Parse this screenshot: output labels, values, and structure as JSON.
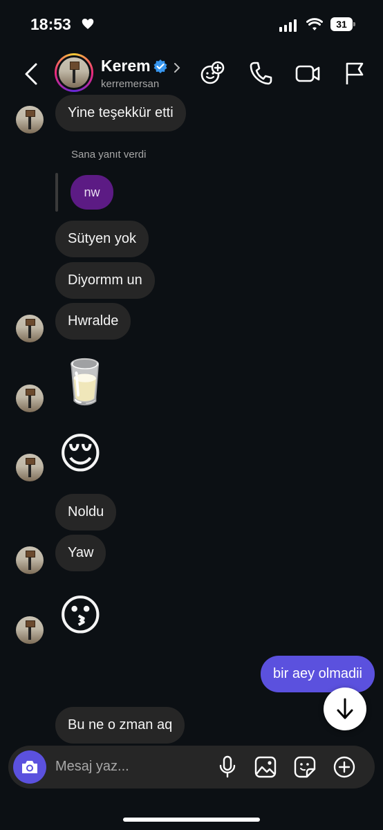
{
  "status_bar": {
    "time": "18:53",
    "battery": "31"
  },
  "header": {
    "name": "Kerem",
    "username": "kerremersan",
    "icons": [
      "back-icon",
      "verified-icon",
      "chevron-right-icon",
      "effects-icon",
      "phone-icon",
      "video-icon",
      "flag-icon"
    ]
  },
  "messages": [
    {
      "from": "them",
      "type": "text",
      "text": "Yine teşekkür etti"
    },
    {
      "from": "them",
      "type": "reply",
      "note": "Sana yanıt verdi",
      "quoted": "nw"
    },
    {
      "from": "them",
      "type": "text",
      "text": "Sütyen yok"
    },
    {
      "from": "them",
      "type": "text",
      "text": "Diyormm un"
    },
    {
      "from": "them",
      "type": "text",
      "text": "Hwralde"
    },
    {
      "from": "them",
      "type": "emoji",
      "text": "🥛"
    },
    {
      "from": "them",
      "type": "emoji",
      "text": "😌"
    },
    {
      "from": "them",
      "type": "text",
      "text": "Noldu"
    },
    {
      "from": "them",
      "type": "text",
      "text": "Yaw"
    },
    {
      "from": "them",
      "type": "emoji",
      "text": "😗"
    },
    {
      "from": "me",
      "type": "text",
      "text": "bir aey olmadii"
    },
    {
      "from": "them",
      "type": "text",
      "text": "Bu ne o zman aq"
    }
  ],
  "composer": {
    "placeholder": "Mesaj yaz...",
    "icons": [
      "camera-icon",
      "microphone-icon",
      "gallery-icon",
      "sticker-icon",
      "add-icon"
    ]
  },
  "colors": {
    "background": "#0c1014",
    "bubble_them": "#262626",
    "bubble_me": "#5b51de",
    "reply_bubble": "#5c1b84"
  }
}
